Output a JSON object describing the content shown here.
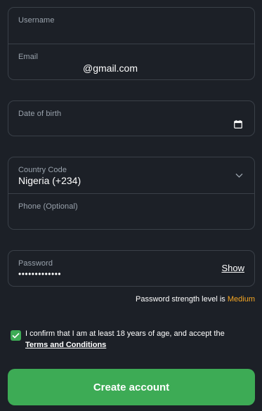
{
  "account_group": {
    "username": {
      "label": "Username",
      "value": ""
    },
    "email": {
      "label": "Email",
      "value": "@gmail.com"
    }
  },
  "dob": {
    "label": "Date of birth",
    "value": "",
    "icon": "calendar-icon"
  },
  "phone_group": {
    "country": {
      "label": "Country Code",
      "value": "Nigeria (+234)",
      "icon": "chevron-down-icon"
    },
    "phone": {
      "label": "Phone (Optional)",
      "value": ""
    }
  },
  "password": {
    "label": "Password",
    "value": "•••••••••••••",
    "show_label": "Show"
  },
  "strength": {
    "prefix": "Password strength level is",
    "level": "Medium",
    "level_color": "#f5a623"
  },
  "consent": {
    "checked": true,
    "text": "I confirm that I am at least 18 years of age, and accept the",
    "link": "Terms and Conditions"
  },
  "submit": {
    "label": "Create account",
    "color": "#3dab55"
  }
}
